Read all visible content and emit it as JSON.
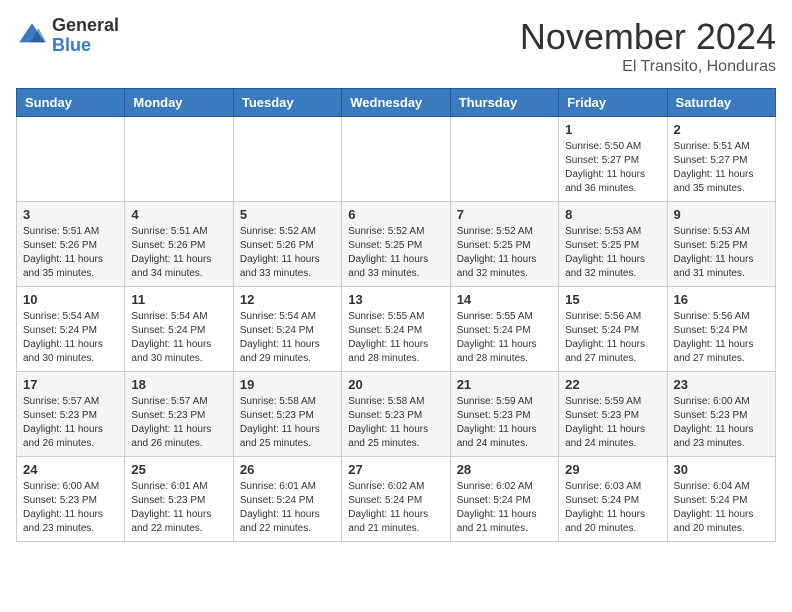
{
  "header": {
    "logo_general": "General",
    "logo_blue": "Blue",
    "month_title": "November 2024",
    "location": "El Transito, Honduras"
  },
  "weekdays": [
    "Sunday",
    "Monday",
    "Tuesday",
    "Wednesday",
    "Thursday",
    "Friday",
    "Saturday"
  ],
  "weeks": [
    [
      {
        "day": "",
        "sunrise": "",
        "sunset": "",
        "daylight": ""
      },
      {
        "day": "",
        "sunrise": "",
        "sunset": "",
        "daylight": ""
      },
      {
        "day": "",
        "sunrise": "",
        "sunset": "",
        "daylight": ""
      },
      {
        "day": "",
        "sunrise": "",
        "sunset": "",
        "daylight": ""
      },
      {
        "day": "",
        "sunrise": "",
        "sunset": "",
        "daylight": ""
      },
      {
        "day": "1",
        "sunrise": "Sunrise: 5:50 AM",
        "sunset": "Sunset: 5:27 PM",
        "daylight": "Daylight: 11 hours and 36 minutes."
      },
      {
        "day": "2",
        "sunrise": "Sunrise: 5:51 AM",
        "sunset": "Sunset: 5:27 PM",
        "daylight": "Daylight: 11 hours and 35 minutes."
      }
    ],
    [
      {
        "day": "3",
        "sunrise": "Sunrise: 5:51 AM",
        "sunset": "Sunset: 5:26 PM",
        "daylight": "Daylight: 11 hours and 35 minutes."
      },
      {
        "day": "4",
        "sunrise": "Sunrise: 5:51 AM",
        "sunset": "Sunset: 5:26 PM",
        "daylight": "Daylight: 11 hours and 34 minutes."
      },
      {
        "day": "5",
        "sunrise": "Sunrise: 5:52 AM",
        "sunset": "Sunset: 5:26 PM",
        "daylight": "Daylight: 11 hours and 33 minutes."
      },
      {
        "day": "6",
        "sunrise": "Sunrise: 5:52 AM",
        "sunset": "Sunset: 5:25 PM",
        "daylight": "Daylight: 11 hours and 33 minutes."
      },
      {
        "day": "7",
        "sunrise": "Sunrise: 5:52 AM",
        "sunset": "Sunset: 5:25 PM",
        "daylight": "Daylight: 11 hours and 32 minutes."
      },
      {
        "day": "8",
        "sunrise": "Sunrise: 5:53 AM",
        "sunset": "Sunset: 5:25 PM",
        "daylight": "Daylight: 11 hours and 32 minutes."
      },
      {
        "day": "9",
        "sunrise": "Sunrise: 5:53 AM",
        "sunset": "Sunset: 5:25 PM",
        "daylight": "Daylight: 11 hours and 31 minutes."
      }
    ],
    [
      {
        "day": "10",
        "sunrise": "Sunrise: 5:54 AM",
        "sunset": "Sunset: 5:24 PM",
        "daylight": "Daylight: 11 hours and 30 minutes."
      },
      {
        "day": "11",
        "sunrise": "Sunrise: 5:54 AM",
        "sunset": "Sunset: 5:24 PM",
        "daylight": "Daylight: 11 hours and 30 minutes."
      },
      {
        "day": "12",
        "sunrise": "Sunrise: 5:54 AM",
        "sunset": "Sunset: 5:24 PM",
        "daylight": "Daylight: 11 hours and 29 minutes."
      },
      {
        "day": "13",
        "sunrise": "Sunrise: 5:55 AM",
        "sunset": "Sunset: 5:24 PM",
        "daylight": "Daylight: 11 hours and 28 minutes."
      },
      {
        "day": "14",
        "sunrise": "Sunrise: 5:55 AM",
        "sunset": "Sunset: 5:24 PM",
        "daylight": "Daylight: 11 hours and 28 minutes."
      },
      {
        "day": "15",
        "sunrise": "Sunrise: 5:56 AM",
        "sunset": "Sunset: 5:24 PM",
        "daylight": "Daylight: 11 hours and 27 minutes."
      },
      {
        "day": "16",
        "sunrise": "Sunrise: 5:56 AM",
        "sunset": "Sunset: 5:24 PM",
        "daylight": "Daylight: 11 hours and 27 minutes."
      }
    ],
    [
      {
        "day": "17",
        "sunrise": "Sunrise: 5:57 AM",
        "sunset": "Sunset: 5:23 PM",
        "daylight": "Daylight: 11 hours and 26 minutes."
      },
      {
        "day": "18",
        "sunrise": "Sunrise: 5:57 AM",
        "sunset": "Sunset: 5:23 PM",
        "daylight": "Daylight: 11 hours and 26 minutes."
      },
      {
        "day": "19",
        "sunrise": "Sunrise: 5:58 AM",
        "sunset": "Sunset: 5:23 PM",
        "daylight": "Daylight: 11 hours and 25 minutes."
      },
      {
        "day": "20",
        "sunrise": "Sunrise: 5:58 AM",
        "sunset": "Sunset: 5:23 PM",
        "daylight": "Daylight: 11 hours and 25 minutes."
      },
      {
        "day": "21",
        "sunrise": "Sunrise: 5:59 AM",
        "sunset": "Sunset: 5:23 PM",
        "daylight": "Daylight: 11 hours and 24 minutes."
      },
      {
        "day": "22",
        "sunrise": "Sunrise: 5:59 AM",
        "sunset": "Sunset: 5:23 PM",
        "daylight": "Daylight: 11 hours and 24 minutes."
      },
      {
        "day": "23",
        "sunrise": "Sunrise: 6:00 AM",
        "sunset": "Sunset: 5:23 PM",
        "daylight": "Daylight: 11 hours and 23 minutes."
      }
    ],
    [
      {
        "day": "24",
        "sunrise": "Sunrise: 6:00 AM",
        "sunset": "Sunset: 5:23 PM",
        "daylight": "Daylight: 11 hours and 23 minutes."
      },
      {
        "day": "25",
        "sunrise": "Sunrise: 6:01 AM",
        "sunset": "Sunset: 5:23 PM",
        "daylight": "Daylight: 11 hours and 22 minutes."
      },
      {
        "day": "26",
        "sunrise": "Sunrise: 6:01 AM",
        "sunset": "Sunset: 5:24 PM",
        "daylight": "Daylight: 11 hours and 22 minutes."
      },
      {
        "day": "27",
        "sunrise": "Sunrise: 6:02 AM",
        "sunset": "Sunset: 5:24 PM",
        "daylight": "Daylight: 11 hours and 21 minutes."
      },
      {
        "day": "28",
        "sunrise": "Sunrise: 6:02 AM",
        "sunset": "Sunset: 5:24 PM",
        "daylight": "Daylight: 11 hours and 21 minutes."
      },
      {
        "day": "29",
        "sunrise": "Sunrise: 6:03 AM",
        "sunset": "Sunset: 5:24 PM",
        "daylight": "Daylight: 11 hours and 20 minutes."
      },
      {
        "day": "30",
        "sunrise": "Sunrise: 6:04 AM",
        "sunset": "Sunset: 5:24 PM",
        "daylight": "Daylight: 11 hours and 20 minutes."
      }
    ]
  ]
}
